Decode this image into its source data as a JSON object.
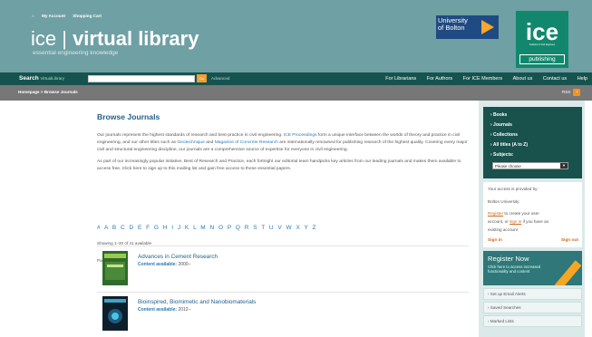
{
  "toplinks": {
    "account": "My Account",
    "cart": "Shopping Cart"
  },
  "brand": {
    "name_light": "ice | ",
    "name_bold": "virtual library",
    "tagline": "essential engineering knowledge",
    "uni_line1": "University",
    "uni_line2": "of Bolton",
    "ice": "ice",
    "ice_sub": "Institution of Civil Engineers",
    "ice_pub": "publishing"
  },
  "nav": {
    "search_label": "Search",
    "search_scope": "VirtualLibrary",
    "go": "Go",
    "advanced": "Advanced",
    "links": [
      "For Librarians",
      "For Authors",
      "For ICE Members",
      "About us",
      "Contact us",
      "Help"
    ]
  },
  "breadcrumb": "Homepage > Browse Journals",
  "rss": "RSS",
  "main": {
    "title": "Browse Journals",
    "p1_a": "Our journals represent the highest standards of research and best-practice in civil engineering.",
    "p1_link1": "ICE Proceedings",
    "p1_b": "form a unique interface between the worlds of theory and practice in civil engineering, and our other titles such as",
    "p1_link2": "Geotechnique",
    "p1_and": "and",
    "p1_link3": "Magazine of Concrete Research",
    "p1_c": "are internationally renowned for publishing research of the highest quality. Covering every major civil and structural engineering discipline, our journals are a comprehensive source of expertise for everyone in civil engineering.",
    "p2": "As part of our increasingly popular initiative, Best of Research and Practice, each fortnight our editorial team handpicks key articles from our leading journals and makes them available to access free. Click here to sign up to this mailing list and gain free access to these essential papers.",
    "alphabet": "# A B C D E F G H I J K L M N O P Q R S T U V W X Y Z",
    "showing": "Showing 1–20 of 41 available",
    "page_label": "Page:",
    "pages": "1 2 3",
    "journals": [
      {
        "title": "Advances in Cement Research",
        "label": "Content available:",
        "value": "2000–"
      },
      {
        "title": "Bioinspired, Biomimetic and Nanobiomaterials",
        "label": "Content available:",
        "value": "2012–"
      }
    ]
  },
  "sidebar": {
    "menu": [
      "› Books",
      "› Journals",
      "› Collections",
      "› All titles (A to Z)",
      "› Subjects:"
    ],
    "select": "Please choose",
    "access_l1": "Your access is provided by:",
    "access_l2": "Bolton University",
    "access_register": "Register",
    "access_l3": "to create your user",
    "access_l4a": "account, or",
    "access_signin_link": "sign in",
    "access_l4b": "if you have an",
    "access_l5": "existing account",
    "signin": "Sign in",
    "signout": "Sign out",
    "register_title": "Register Now",
    "register_text1": "Click here to access increased",
    "register_text2": "functionality and content",
    "links": [
      "› Set up Email Alerts",
      "› Saved Searches",
      "› Marked Lists"
    ]
  }
}
